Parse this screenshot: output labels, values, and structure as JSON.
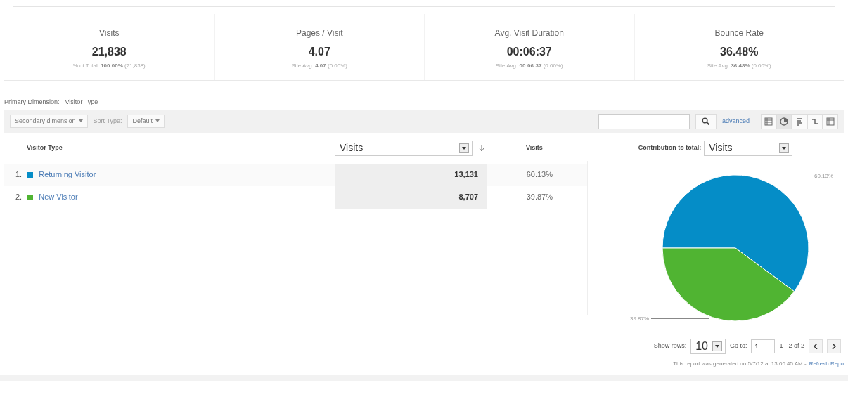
{
  "metrics": [
    {
      "label": "Visits",
      "value": "21,838",
      "sub": "% of Total: **100.00%** (21,838)"
    },
    {
      "label": "Pages / Visit",
      "value": "4.07",
      "sub": "Site Avg: **4.07** (0.00%)"
    },
    {
      "label": "Avg. Visit Duration",
      "value": "00:06:37",
      "sub": "Site Avg: **00:06:37** (0.00%)"
    },
    {
      "label": "Bounce Rate",
      "value": "36.48%",
      "sub": "Site Avg: **36.48%** (0.00%)"
    }
  ],
  "primary_dimension": {
    "label": "Primary Dimension:",
    "value": "Visitor Type"
  },
  "toolbar": {
    "secondary": "Secondary dimension",
    "sort_label": "Sort Type:",
    "sort_value": "Default",
    "advanced": "advanced"
  },
  "table": {
    "dimension_header": "Visitor Type",
    "metric_select": "Visits",
    "percent_header": "Visits",
    "contribution_label": "Contribution to total:",
    "contribution_select": "Visits",
    "rows": [
      {
        "index": "1.",
        "name": "Returning Visitor",
        "color": "#058dc7",
        "value": "13,131",
        "percent": "60.13%"
      },
      {
        "index": "2.",
        "name": "New Visitor",
        "color": "#50b432",
        "value": "8,707",
        "percent": "39.87%"
      }
    ]
  },
  "chart_data": {
    "type": "pie",
    "values": [
      60.13,
      39.87
    ],
    "value_labels": [
      "60.13%",
      "39.87%"
    ]
  },
  "pagination": {
    "show_rows_label": "Show rows:",
    "show_rows": "10",
    "goto_label": "Go to:",
    "goto": "1",
    "range": "1 - 2 of 2"
  },
  "footer": {
    "note": "This report was generated on 5/7/12 at 13:06:45 AM -",
    "refresh": "Refresh Repo"
  }
}
